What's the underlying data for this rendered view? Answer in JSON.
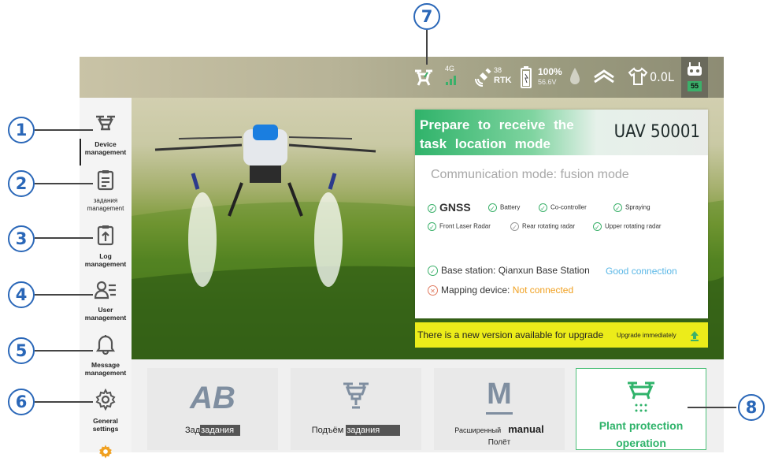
{
  "callouts": [
    "1",
    "2",
    "3",
    "4",
    "5",
    "6",
    "7",
    "8"
  ],
  "status_bar": {
    "network": "4G",
    "satellites": "38",
    "rtk": "RTK",
    "battery_percent": "100%",
    "battery_voltage": "56.6V",
    "liquid": "0.0L",
    "controller_badge": "55"
  },
  "sidebar": {
    "items": [
      {
        "label": "Device management",
        "icon": "drone-icon"
      },
      {
        "label": "задания management",
        "icon": "clipboard-icon"
      },
      {
        "label": "Log management",
        "icon": "upload-log-icon"
      },
      {
        "label": "User management",
        "icon": "user-list-icon"
      },
      {
        "label": "Message management",
        "icon": "bell-icon"
      },
      {
        "label": "General settings",
        "icon": "gear-icon"
      }
    ],
    "footer_icon": "gear-icon"
  },
  "panel": {
    "title": "Prepare to receive the task location mode",
    "uav": "UAV 50001",
    "mode": "Communication mode: fusion mode",
    "checks_row1": [
      "GNSS",
      "Battery",
      "Co-controller",
      "Spraying"
    ],
    "checks_row2": [
      "Front Laser Radar",
      "Rear rotating radar",
      "Upper rotating radar"
    ],
    "base_station_label": "Base station: Qianxun Base Station",
    "base_station_status": "Good connection",
    "mapping_label": "Mapping device:",
    "mapping_status": "Not connected",
    "upgrade_text": "There is a new version available for upgrade",
    "upgrade_button": "Upgrade immediately"
  },
  "cards": [
    {
      "icon_text": "AB",
      "label_pre": "Зад",
      "label_hl": "задания"
    },
    {
      "label_pre": "Подъём",
      "label_hl": "задания"
    },
    {
      "icon_text": "M",
      "label_small": "Расширенный",
      "label_bold": "manual",
      "label_line2": "Полёт"
    },
    {
      "label_line1": "Plant protection",
      "label_line2": "operation"
    }
  ],
  "colors": {
    "accent_green": "#2fb36a",
    "callout_blue": "#2a67b8",
    "upgrade_yellow": "#ecec1a"
  }
}
